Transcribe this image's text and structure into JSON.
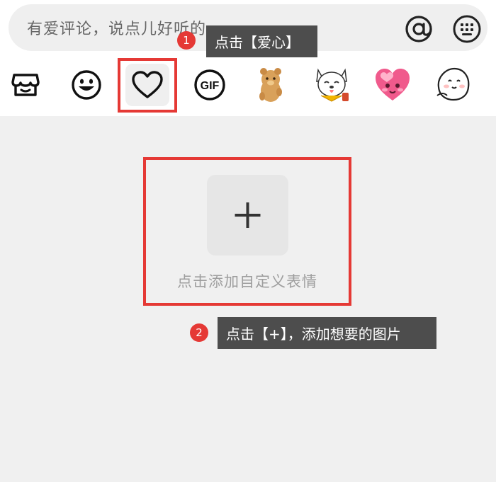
{
  "comment_input": {
    "placeholder": "有爱评论，说点儿好听的"
  },
  "toolbar": {
    "mention_icon": "at-icon",
    "keyboard_icon": "keyboard-icon"
  },
  "emoji_tabs": [
    {
      "name": "store",
      "icon": "store-icon"
    },
    {
      "name": "emoji",
      "icon": "smiley-icon"
    },
    {
      "name": "favorites",
      "icon": "heart-icon",
      "selected": true
    },
    {
      "name": "gif",
      "icon": "gif-icon",
      "text": "GIF"
    },
    {
      "name": "bear-sticker",
      "icon": "bear-sticker-icon"
    },
    {
      "name": "dog-sticker",
      "icon": "dog-sticker-icon"
    },
    {
      "name": "heart-sticker",
      "icon": "pink-heart-sticker-icon"
    },
    {
      "name": "bun-sticker",
      "icon": "bun-sticker-icon"
    }
  ],
  "steps": [
    {
      "number": "1",
      "text": "点击【爱心】"
    },
    {
      "number": "2",
      "text": "点击【+】，添加想要的图片"
    }
  ],
  "add_custom": {
    "label": "点击添加自定义表情",
    "icon": "plus-icon"
  },
  "colors": {
    "highlight": "#e53935",
    "callout_bg": "#4d4d4d",
    "panel_bg": "#f0f0f0"
  }
}
